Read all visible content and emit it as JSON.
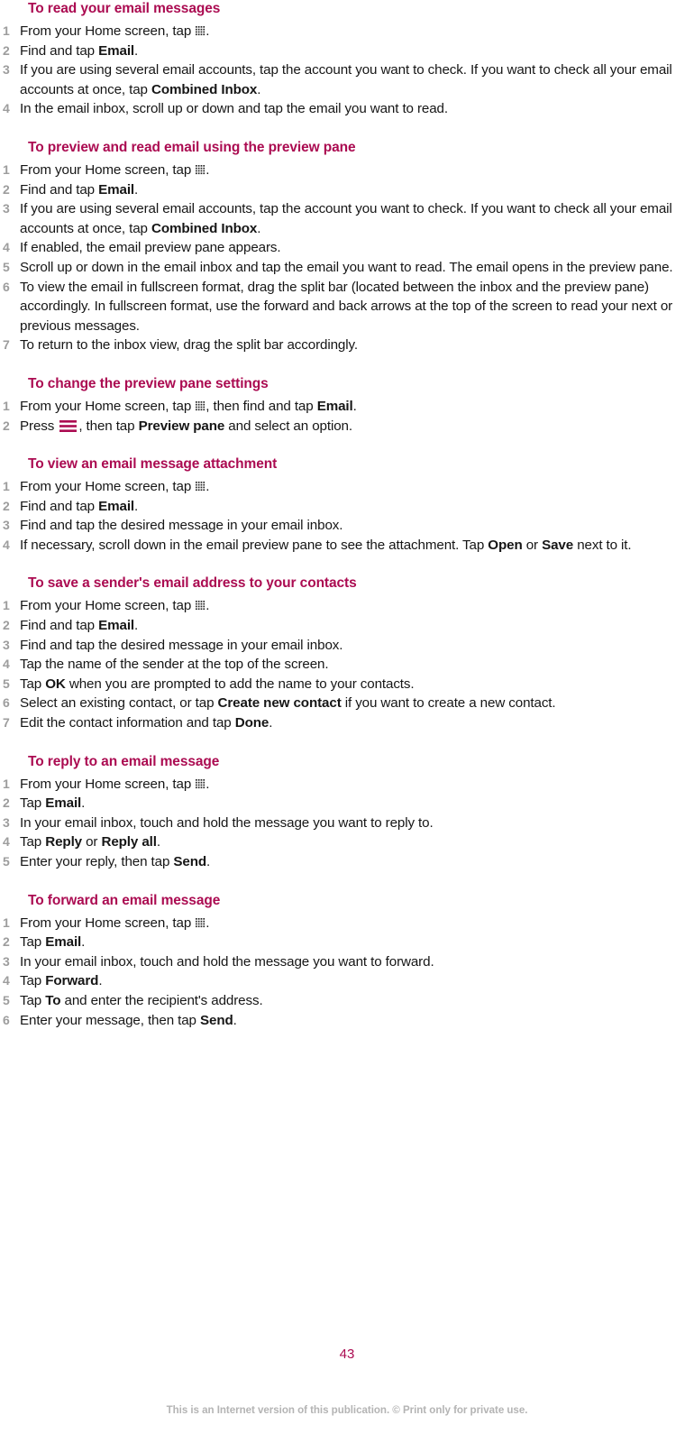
{
  "document": {
    "page_number": "43",
    "footer_note_plain": "This is an Internet version of this publication. © Print only for private use.",
    "heading_color": "#ab0b51",
    "step_number_color": "#9d9d9d",
    "body_text_color": "#161616",
    "footer_color": "#b4b4b4"
  },
  "icons": {
    "app_grid": "app-grid-icon",
    "menu": "menu-icon"
  },
  "sections": [
    {
      "heading": "To read your email messages",
      "steps": [
        {
          "num": "1",
          "html": "From your Home screen, tap <span class=\"icon-appgrid\" data-name=\"app-grid-icon\" data-interactable=\"false\"></span>."
        },
        {
          "num": "2",
          "html": "Find and tap <b>Email</b>."
        },
        {
          "num": "3",
          "html": "If you are using several email accounts, tap the account you want to check. If you want to check all your email accounts at once, tap <b>Combined Inbox</b>."
        },
        {
          "num": "4",
          "html": "In the email inbox, scroll up or down and tap the email you want to read."
        }
      ]
    },
    {
      "heading": "To preview and read email using the preview pane",
      "steps": [
        {
          "num": "1",
          "html": "From your Home screen, tap <span class=\"icon-appgrid\" data-name=\"app-grid-icon\" data-interactable=\"false\"></span>."
        },
        {
          "num": "2",
          "html": "Find and tap <b>Email</b>."
        },
        {
          "num": "3",
          "html": "If you are using several email accounts, tap the account you want to check. If you want to check all your email accounts at once, tap <b>Combined Inbox</b>."
        },
        {
          "num": "4",
          "html": "If enabled, the email preview pane appears."
        },
        {
          "num": "5",
          "html": "Scroll up or down in the email inbox and tap the email you want to read. The email opens in the preview pane."
        },
        {
          "num": "6",
          "html": "To view the email in fullscreen format, drag the split bar (located between the inbox and the preview pane) accordingly. In fullscreen format, use the forward and back arrows at the top of the screen to read your next or previous messages."
        },
        {
          "num": "7",
          "html": "To return to the inbox view, drag the split bar accordingly."
        }
      ]
    },
    {
      "heading": "To change the preview pane settings",
      "steps": [
        {
          "num": "1",
          "html": "From your Home screen, tap <span class=\"icon-appgrid\" data-name=\"app-grid-icon\" data-interactable=\"false\"></span>, then find and tap <b>Email</b>."
        },
        {
          "num": "2",
          "html": "Press <span class=\"icon-menu\" data-name=\"menu-icon\" data-interactable=\"false\"></span>, then tap <b>Preview pane</b> and select an option."
        }
      ]
    },
    {
      "heading": "To view an email message attachment",
      "steps": [
        {
          "num": "1",
          "html": "From your Home screen, tap <span class=\"icon-appgrid\" data-name=\"app-grid-icon\" data-interactable=\"false\"></span>."
        },
        {
          "num": "2",
          "html": "Find and tap <b>Email</b>."
        },
        {
          "num": "3",
          "html": "Find and tap the desired message in your email inbox."
        },
        {
          "num": "4",
          "html": "If necessary, scroll down in the email preview pane to see the attachment. Tap <b>Open</b> or <b>Save</b> next to it."
        }
      ]
    },
    {
      "heading": "To save a sender's email address to your contacts",
      "steps": [
        {
          "num": "1",
          "html": "From your Home screen, tap <span class=\"icon-appgrid\" data-name=\"app-grid-icon\" data-interactable=\"false\"></span>."
        },
        {
          "num": "2",
          "html": "Find and tap <b>Email</b>."
        },
        {
          "num": "3",
          "html": "Find and tap the desired message in your email inbox."
        },
        {
          "num": "4",
          "html": "Tap the name of the sender at the top of the screen."
        },
        {
          "num": "5",
          "html": "Tap <b>OK</b> when you are prompted to add the name to your contacts."
        },
        {
          "num": "6",
          "html": "Select an existing contact, or tap <b>Create new contact</b> if you want to create a new contact."
        },
        {
          "num": "7",
          "html": "Edit the contact information and tap <b>Done</b>."
        }
      ]
    },
    {
      "heading": "To reply to an email message",
      "steps": [
        {
          "num": "1",
          "html": "From your Home screen, tap <span class=\"icon-appgrid\" data-name=\"app-grid-icon\" data-interactable=\"false\"></span>."
        },
        {
          "num": "2",
          "html": "Tap <b>Email</b>."
        },
        {
          "num": "3",
          "html": "In your email inbox, touch and hold the message you want to reply to."
        },
        {
          "num": "4",
          "html": "Tap <b>Reply</b> or <b>Reply all</b>."
        },
        {
          "num": "5",
          "html": "Enter your reply, then tap <b>Send</b>."
        }
      ]
    },
    {
      "heading": "To forward an email message",
      "steps": [
        {
          "num": "1",
          "html": "From your Home screen, tap <span class=\"icon-appgrid\" data-name=\"app-grid-icon\" data-interactable=\"false\"></span>."
        },
        {
          "num": "2",
          "html": "Tap <b>Email</b>."
        },
        {
          "num": "3",
          "html": "In your email inbox, touch and hold the message you want to forward."
        },
        {
          "num": "4",
          "html": "Tap <b>Forward</b>."
        },
        {
          "num": "5",
          "html": "Tap <b>To</b> and enter the recipient's address."
        },
        {
          "num": "6",
          "html": "Enter your message, then tap <b>Send</b>."
        }
      ]
    }
  ],
  "footer": {
    "part_bold": "This is an Internet version of this publication. © Print only for private use.",
    "part_plain": ""
  }
}
